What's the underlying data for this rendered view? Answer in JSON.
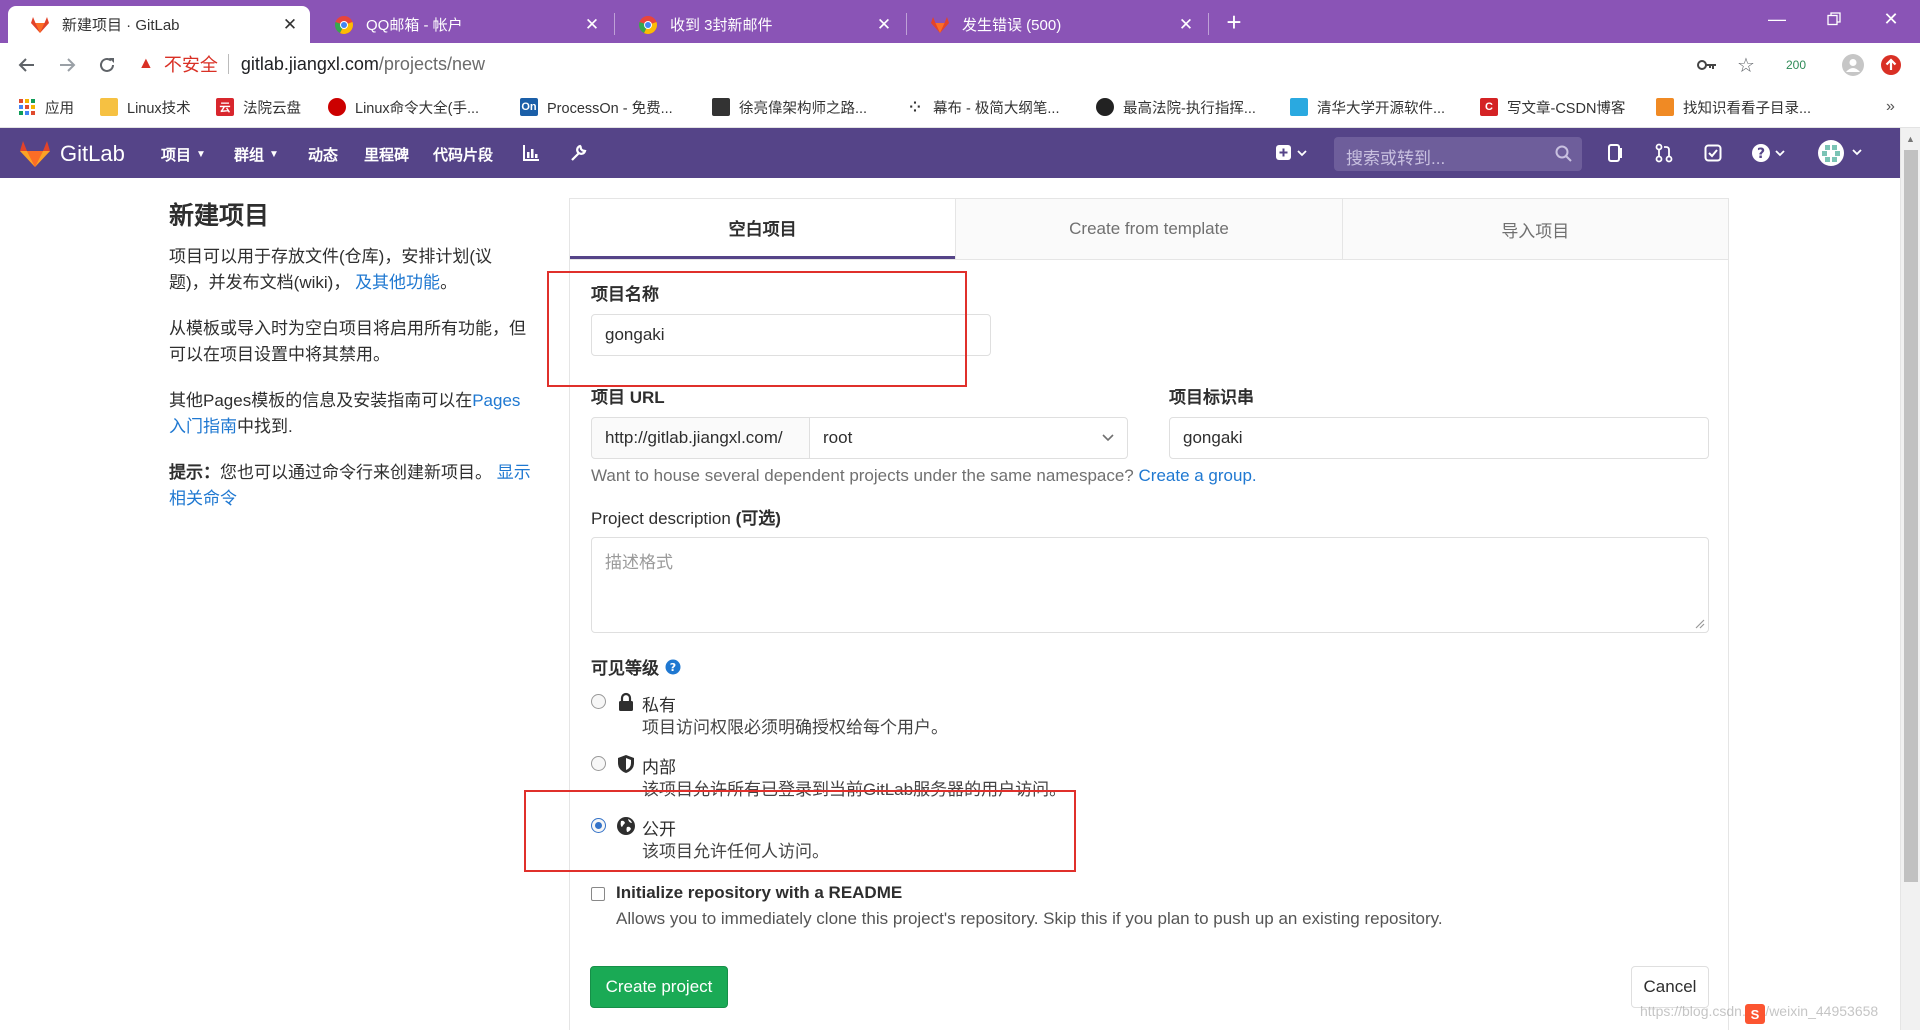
{
  "browser": {
    "tabs": [
      {
        "label": "新建项目 · GitLab",
        "active": true,
        "icon": "gitlab-icon"
      },
      {
        "label": "QQ邮箱 - 帐户",
        "active": false,
        "icon": "chrome-icon"
      },
      {
        "label": "收到 3封新邮件",
        "active": false,
        "icon": "chrome-icon"
      },
      {
        "label": "发生错误 (500)",
        "active": false,
        "icon": "gitlab-icon"
      }
    ],
    "new_tab": "+",
    "insecure_label": "不安全",
    "url_host": "gitlab.jiangxl.com",
    "url_path": "/projects/new",
    "ext_badge": "200",
    "bookmarks": [
      {
        "label": "应用",
        "icon": "apps-grid-icon",
        "color": "#e04b2e"
      },
      {
        "label": "Linux技术",
        "icon": "folder-icon",
        "color": "#f6c142"
      },
      {
        "label": "法院云盘",
        "icon": "cloud-icon",
        "color": "#d8262d"
      },
      {
        "label": "Linux命令大全(手...",
        "icon": "redhat-icon",
        "color": "#cc0000"
      },
      {
        "label": "ProcessOn - 免费...",
        "icon": "processon-icon",
        "color": "#1b5fa8"
      },
      {
        "label": "徐亮偉架构师之路...",
        "icon": "blog-icon",
        "color": "#333333"
      },
      {
        "label": "幕布 - 极简大纲笔...",
        "icon": "mubu-icon",
        "color": "#333333"
      },
      {
        "label": "最高法院-执行指挥...",
        "icon": "court-icon",
        "color": "#222222"
      },
      {
        "label": "清华大学开源软件...",
        "icon": "tuna-icon",
        "color": "#2aa9e0"
      },
      {
        "label": "写文章-CSDN博客",
        "icon": "csdn-icon",
        "color": "#d42224"
      },
      {
        "label": "找知识看看子目录...",
        "icon": "zhishi-icon",
        "color": "#f08a24"
      }
    ],
    "more_bookmarks": "»"
  },
  "gitlab": {
    "brand": "GitLab",
    "nav": [
      {
        "label": "项目",
        "dropdown": true
      },
      {
        "label": "群组",
        "dropdown": true
      },
      {
        "label": "动态",
        "dropdown": false
      },
      {
        "label": "里程碑",
        "dropdown": false
      },
      {
        "label": "代码片段",
        "dropdown": false
      }
    ],
    "search_placeholder": "搜索或转到...",
    "header_color": "#554488"
  },
  "sidebar": {
    "title": "新建项目",
    "p1_text": "项目可以用于存放文件(仓库)，安排计划(议题)，并发布文档(wiki)，",
    "p1_link": "及其他功能",
    "p1_end": "。",
    "p2_text": "从模板或导入时为空白项目将启用所有功能，但可以在项目设置中将其禁用。",
    "p3_text": "其他Pages模板的信息及安装指南可以在",
    "p3_link": "Pages入门指南",
    "p3_end": "中找到.",
    "tip_label": "提示：",
    "tip_text": "您也可以通过命令行来创建新项目。",
    "tip_link": "显示相关命令"
  },
  "form": {
    "tabs": [
      {
        "label": "空白项目",
        "active": true
      },
      {
        "label": "Create from template",
        "active": false
      },
      {
        "label": "导入项目",
        "active": false
      }
    ],
    "name_label": "项目名称",
    "name_value": "gongaki",
    "url_label": "项目 URL",
    "url_prefix": "http://gitlab.jiangxl.com/",
    "namespace_value": "root",
    "slug_label": "项目标识串",
    "slug_value": "gongaki",
    "group_help": "Want to house several dependent projects under the same namespace?",
    "group_link": "Create a group.",
    "desc_label": "Project description",
    "desc_optional": "(可选)",
    "desc_placeholder": "描述格式",
    "visibility_label": "可见等级",
    "visibility": [
      {
        "title": "私有",
        "desc": "项目访问权限必须明确授权给每个用户。",
        "icon": "lock-icon",
        "checked": false
      },
      {
        "title": "内部",
        "desc": "该项目允许所有已登录到当前GitLab服务器的用户访问。",
        "icon": "shield-icon",
        "checked": false
      },
      {
        "title": "公开",
        "desc": "该项目允许任何人访问。",
        "icon": "globe-icon",
        "checked": true
      }
    ],
    "readme_label": "Initialize repository with a README",
    "readme_help": "Allows you to immediately clone this project's repository. Skip this if you plan to push up an existing repository.",
    "readme_checked": false,
    "create_label": "Create project",
    "cancel_label": "Cancel"
  },
  "watermark": "https://blog.csdn.net/weixin_44953658"
}
